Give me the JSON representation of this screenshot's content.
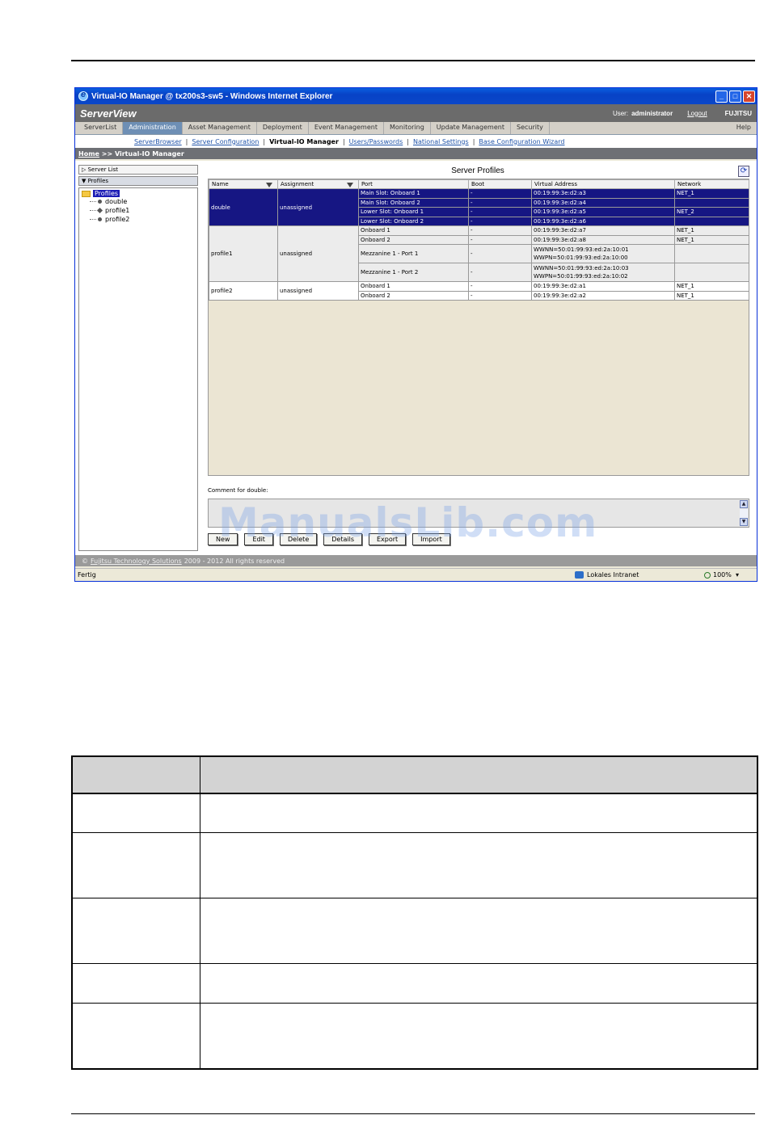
{
  "window": {
    "title": "Virtual-IO Manager @ tx200s3-sw5 - Windows Internet Explorer"
  },
  "header": {
    "logo": "ServerView",
    "user_label": "User:",
    "user_name": "administrator",
    "logout": "Logout",
    "brand": "FUJITSU"
  },
  "main_tabs": [
    "ServerList",
    "Administration",
    "Asset Management",
    "Deployment",
    "Event Management",
    "Monitoring",
    "Update Management",
    "Security",
    "Help"
  ],
  "sub_tabs": [
    "ServerBrowser",
    "Server Configuration",
    "Virtual-IO Manager",
    "Users/Passwords",
    "National Settings",
    "Base Configuration Wizard"
  ],
  "breadcrumb": {
    "home": "Home",
    "rest": ">> Virtual-IO Manager"
  },
  "left_panel": {
    "server_list": "Server List",
    "profiles": "Profiles",
    "tree_root": "Profiles",
    "tree_items": [
      "double",
      "profile1",
      "profile2"
    ]
  },
  "profiles_panel": {
    "title": "Server Profiles",
    "columns": [
      "Name",
      "Assignment",
      "Port",
      "Boot",
      "Virtual Address",
      "Network"
    ],
    "rows": [
      {
        "name": "double",
        "assignment": "unassigned",
        "ports": [
          {
            "port": "Main Slot: Onboard 1",
            "boot": "-",
            "address": "00:19:99:3e:d2:a3",
            "network": "NET_1"
          },
          {
            "port": "Main Slot: Onboard 2",
            "boot": "-",
            "address": "00:19:99:3e:d2:a4",
            "network": ""
          },
          {
            "port": "Lower Slot: Onboard 1",
            "boot": "-",
            "address": "00:19:99:3e:d2:a5",
            "network": "NET_2"
          },
          {
            "port": "Lower Slot: Onboard 2",
            "boot": "-",
            "address": "00:19:99:3e:d2:a6",
            "network": ""
          }
        ]
      },
      {
        "name": "profile1",
        "assignment": "unassigned",
        "ports": [
          {
            "port": "Onboard 1",
            "boot": "-",
            "address": "00:19:99:3e:d2:a7",
            "network": "NET_1"
          },
          {
            "port": "Onboard 2",
            "boot": "-",
            "address": "00:19:99:3e:d2:a8",
            "network": "NET_1"
          },
          {
            "port": "Mezzanine 1 - Port 1",
            "boot": "-",
            "address": "WWNN=50:01:99:93:ed:2a:10:01",
            "address2": "WWPN=50:01:99:93:ed:2a:10:00",
            "network": ""
          },
          {
            "port": "Mezzanine 1 - Port 2",
            "boot": "-",
            "address": "WWNN=50:01:99:93:ed:2a:10:03",
            "address2": "WWPN=50:01:99:93:ed:2a:10:02",
            "network": ""
          }
        ]
      },
      {
        "name": "profile2",
        "assignment": "unassigned",
        "ports": [
          {
            "port": "Onboard 1",
            "boot": "-",
            "address": "00:19:99:3e:d2:a1",
            "network": "NET_1"
          },
          {
            "port": "Onboard 2",
            "boot": "-",
            "address": "00:19:99:3e:d2:a2",
            "network": "NET_1"
          }
        ]
      }
    ],
    "comment_label": "Comment for double:",
    "buttons": [
      "New",
      "Edit",
      "Delete",
      "Details",
      "Export",
      "Import"
    ]
  },
  "footer": {
    "copyright_prefix": "©",
    "company_link": "Fujitsu Technology Solutions",
    "copyright_rest": "2009 - 2012  All rights reserved"
  },
  "statusbar": {
    "status": "Fertig",
    "zone": "Lokales Intranet",
    "zoom": "100%"
  },
  "watermark": "ManualsLib.com"
}
